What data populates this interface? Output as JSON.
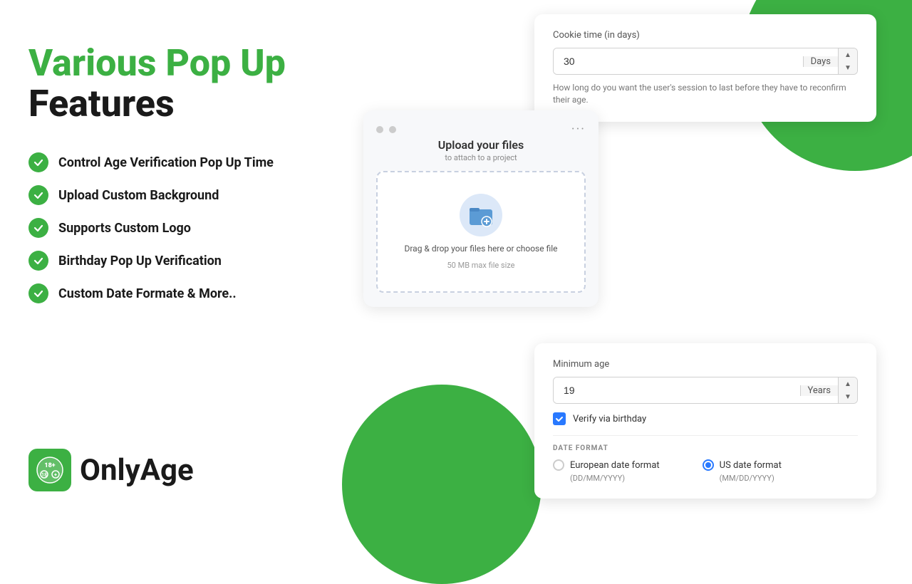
{
  "page": {
    "headline_green": "Various Pop Up",
    "headline_black": "Features"
  },
  "features": [
    {
      "id": "feature-1",
      "label": "Control Age Verification Pop Up Time"
    },
    {
      "id": "feature-2",
      "label": "Upload Custom Background"
    },
    {
      "id": "feature-3",
      "label": "Supports Custom Logo"
    },
    {
      "id": "feature-4",
      "label": "Birthday Pop Up Verification"
    },
    {
      "id": "feature-5",
      "label": "Custom Date Formate & More.."
    }
  ],
  "logo": {
    "icon_text": "18+",
    "name": "OnlyAge"
  },
  "cookie_card": {
    "label": "Cookie time (in days)",
    "value": "30",
    "unit": "Days",
    "hint": "How long do you want the user's session to last before they have to reconfirm their age."
  },
  "upload_card": {
    "title": "Upload your files",
    "subtitle": "to attach to a project",
    "drop_text": "Drag & drop your files here or choose file",
    "drop_hint": "50 MB max file size"
  },
  "age_card": {
    "label": "Minimum age",
    "value": "19",
    "unit": "Years",
    "verify_label": "Verify via birthday",
    "date_format_title": "DATE FORMAT",
    "date_options": [
      {
        "id": "european",
        "label": "European date format",
        "format": "(DD/MM/YYYY)",
        "selected": false
      },
      {
        "id": "us",
        "label": "US date format",
        "format": "(MM/DD/YYYY)",
        "selected": true
      }
    ]
  },
  "icons": {
    "check": "✓",
    "arrow_up": "▲",
    "arrow_down": "▼",
    "more": "•••",
    "folder": "📁"
  },
  "colors": {
    "green": "#3cb043",
    "blue": "#2979ff"
  }
}
